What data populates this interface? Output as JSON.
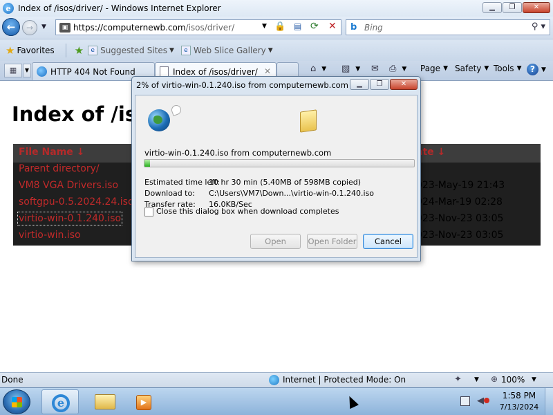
{
  "window": {
    "title": "Index of /isos/driver/ - Windows Internet Explorer",
    "buttons": {
      "minimize": "▁",
      "maximize": "❐",
      "close": "✕"
    }
  },
  "nav": {
    "url_host": "https://computernewb.com",
    "url_path": "/isos/driver/",
    "search_placeholder": "Bing"
  },
  "favorites_bar": {
    "favorites_label": "Favorites",
    "items": [
      "Suggested Sites",
      "Web Slice Gallery"
    ]
  },
  "tabs": [
    {
      "label": "HTTP 404 Not Found",
      "active": false
    },
    {
      "label": "Index of /isos/driver/",
      "active": true
    }
  ],
  "command_bar": {
    "page": "Page",
    "safety": "Safety",
    "tools": "Tools"
  },
  "page": {
    "title": "Index of /iso",
    "headers": {
      "name": "File Name ↓",
      "date": "ate ↓"
    },
    "rows": [
      {
        "name": "Parent directory/",
        "date": ""
      },
      {
        "name": "VM8 VGA Drivers.iso",
        "date": "023-May-19 21:43"
      },
      {
        "name": "softgpu-0.5.2024.24.iso",
        "date": "024-Mar-19 02:28"
      },
      {
        "name": "virtio-win-0.1.240.iso",
        "date": "023-Nov-23 03:05",
        "focused": true
      },
      {
        "name": "virtio-win.iso",
        "date": "023-Nov-23 03:05"
      }
    ]
  },
  "download_dialog": {
    "title": "2% of virtio-win-0.1.240.iso from computernewb.com C...",
    "file_line": "virtio-win-0.1.240.iso from computernewb.com",
    "progress_fraction": 0.02,
    "estimated_label": "Estimated time left:",
    "estimated_value": "10 hr 30 min (5.40MB of 598MB copied)",
    "download_to_label": "Download to:",
    "download_to_value": "C:\\Users\\VM7\\Down...\\virtio-win-0.1.240.iso",
    "rate_label": "Transfer rate:",
    "rate_value": "16.0KB/Sec",
    "checkbox_label": "Close this dialog box when download completes",
    "checkbox_checked": false,
    "buttons": {
      "open": "Open",
      "open_folder": "Open Folder",
      "cancel": "Cancel"
    }
  },
  "status_bar": {
    "status": "Done",
    "zone": "Internet | Protected Mode: On",
    "zoom": "100%"
  },
  "taskbar": {
    "time": "1:58 PM",
    "date": "7/13/2024"
  }
}
